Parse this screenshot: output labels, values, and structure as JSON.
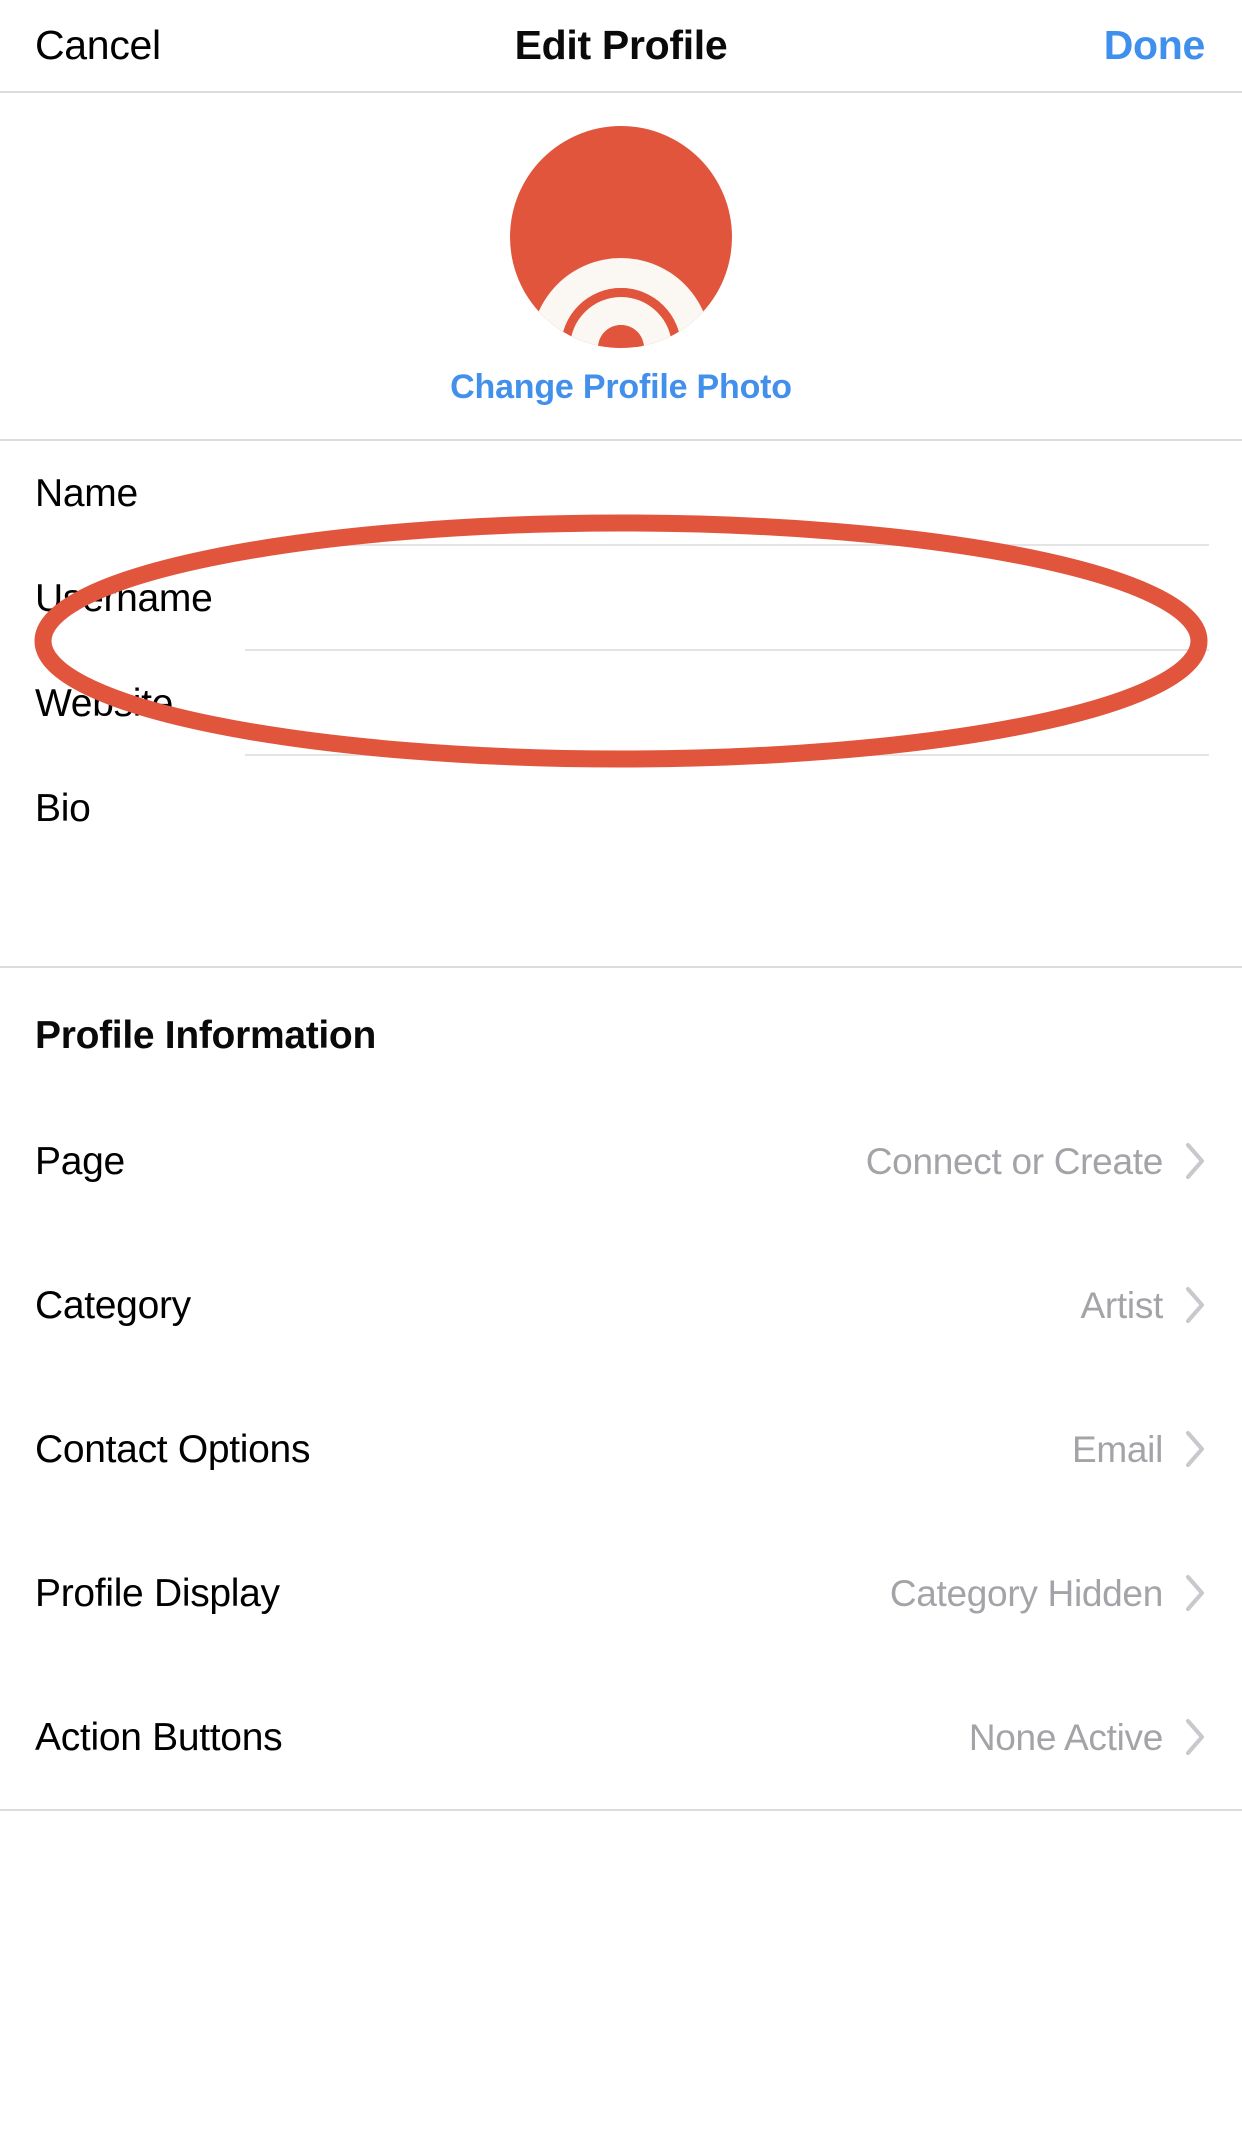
{
  "navbar": {
    "cancel_label": "Cancel",
    "title": "Edit Profile",
    "done_label": "Done"
  },
  "avatar": {
    "change_photo_label": "Change Profile Photo",
    "background_color": "#e1553d",
    "arc_color": "#fbf8f3",
    "icon_name": "rainbow-arcs-logo"
  },
  "fields": [
    {
      "label": "Name",
      "value": "",
      "placeholder": ""
    },
    {
      "label": "Username",
      "value": "",
      "placeholder": ""
    },
    {
      "label": "Website",
      "value": "",
      "placeholder": ""
    },
    {
      "label": "Bio",
      "value": "",
      "placeholder": ""
    }
  ],
  "annotation": {
    "shape": "ellipse",
    "color": "#e1553d",
    "targets": "Website"
  },
  "profile_information": {
    "section_title": "Profile Information",
    "rows": [
      {
        "label": "Page",
        "value": "Connect or Create"
      },
      {
        "label": "Category",
        "value": "Artist"
      },
      {
        "label": "Contact Options",
        "value": "Email"
      },
      {
        "label": "Profile Display",
        "value": "Category Hidden"
      },
      {
        "label": "Action Buttons",
        "value": "None Active"
      }
    ]
  },
  "colors": {
    "accent_blue": "#4290ec",
    "brand_red": "#e1553d",
    "divider": "#dcdcdc",
    "value_gray": "#a3a3a8"
  }
}
